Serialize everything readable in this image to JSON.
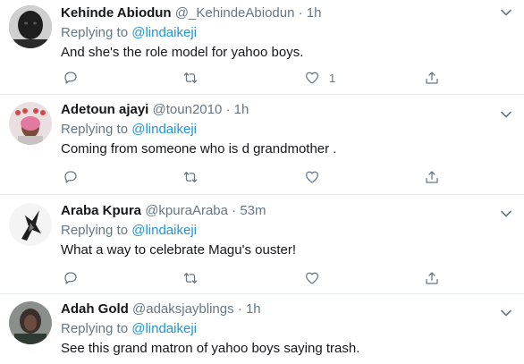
{
  "labels": {
    "replying_to": "Replying to"
  },
  "colors": {
    "link": "#1b95e0",
    "muted": "#657786",
    "divider": "#e6ecf0"
  },
  "icons": {
    "reply": "reply-icon",
    "retweet": "retweet-icon",
    "like": "heart-icon",
    "share": "share-icon",
    "more": "chevron-down-icon"
  },
  "tweets": [
    {
      "name": "Kehinde Abiodun",
      "handle": "@_KehindeAbiodun",
      "dot": "·",
      "time": "1h",
      "mention": "@lindaikeji",
      "text": "And she's the role model for yahoo boys.",
      "likes": "1"
    },
    {
      "name": "Adetoun ajayi",
      "handle": "@toun2010",
      "dot": "·",
      "time": "1h",
      "mention": "@lindaikeji",
      "text": "Coming from someone who is d grandmother ."
    },
    {
      "name": "Araba Kpura",
      "handle": "@kpuraAraba",
      "dot": "·",
      "time": "53m",
      "mention": "@lindaikeji",
      "text": "What a way to celebrate Magu's ouster!"
    },
    {
      "name": "Adah Gold",
      "handle": "@adaksjayblings",
      "dot": "·",
      "time": "1h",
      "mention": "@lindaikeji",
      "text": "See this grand matron of yahoo boys saying trash."
    }
  ]
}
